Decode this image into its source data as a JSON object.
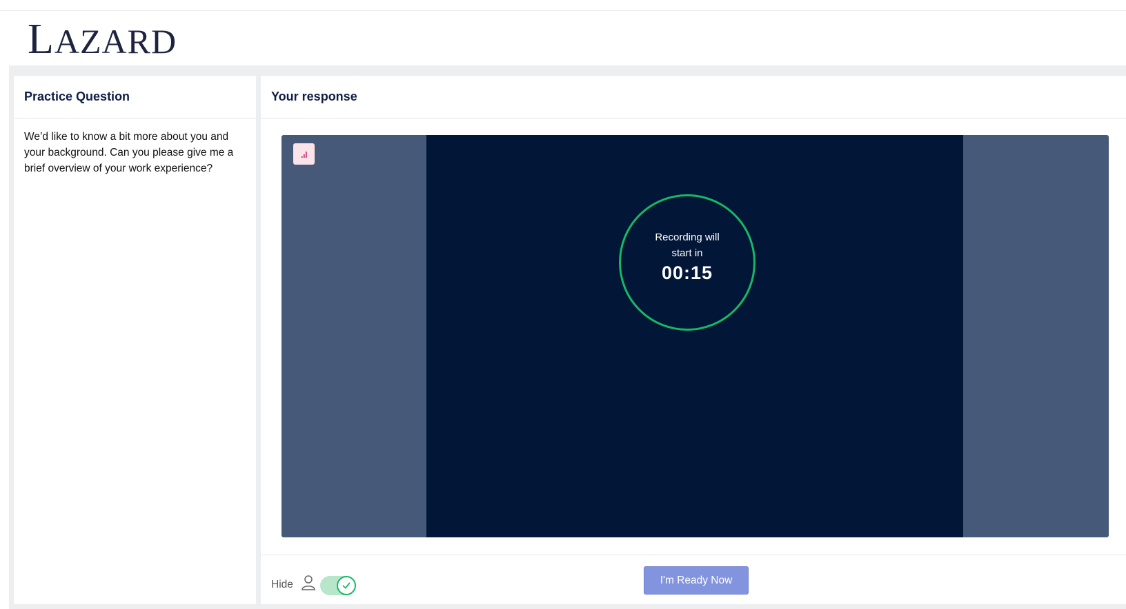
{
  "brand": {
    "logo_first": "L",
    "logo_rest": "AZARD"
  },
  "question_panel": {
    "title": "Practice Question",
    "text": "We’d like to know a bit more about you and your background. Can you please give me a brief overview of your work experience?"
  },
  "response_panel": {
    "title": "Your response",
    "mic_icon": "audio-level-icon",
    "countdown": {
      "label": "Recording will start in",
      "time": "00:15"
    },
    "footer": {
      "hide_label": "Hide",
      "person_icon": "person-icon",
      "toggle_on": true,
      "ready_button_label": "I'm Ready Now"
    }
  },
  "colors": {
    "brand_navy": "#0f1e45",
    "video_dark": "#021637",
    "video_side": "#475978",
    "ring_green": "#18b864",
    "button_blue": "#8294de"
  }
}
